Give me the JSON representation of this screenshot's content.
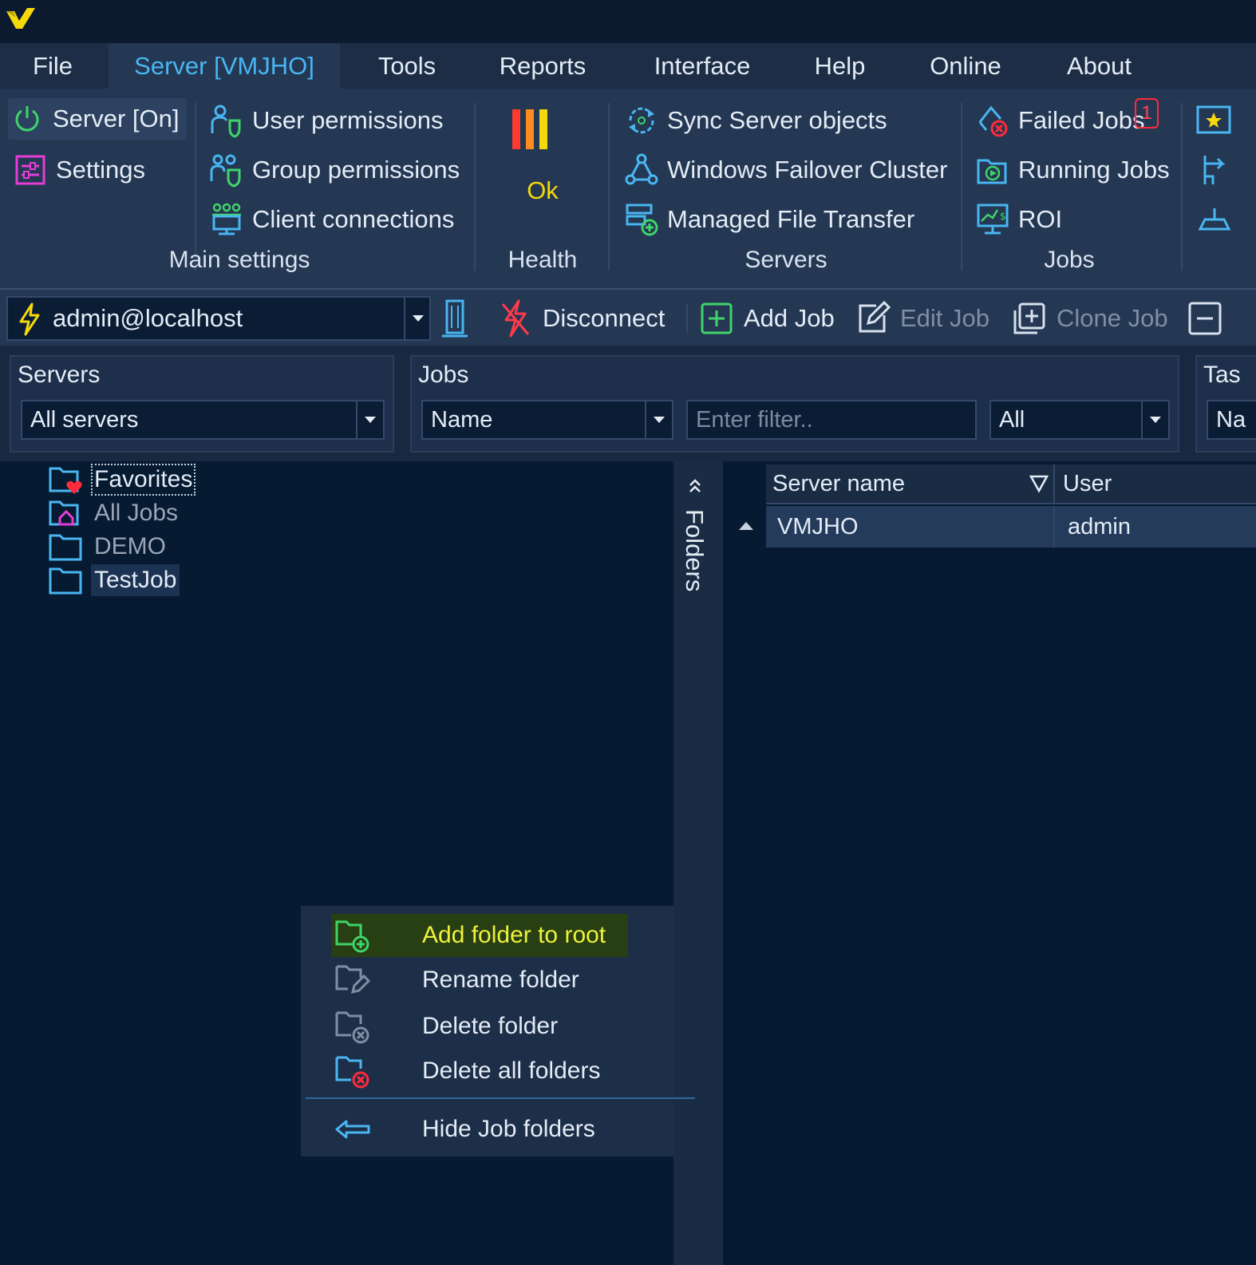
{
  "menu": {
    "tabs": [
      {
        "label": "File"
      },
      {
        "label": "Server [VMJHO]"
      },
      {
        "label": "Tools"
      },
      {
        "label": "Reports"
      },
      {
        "label": "Interface"
      },
      {
        "label": "Help"
      },
      {
        "label": "Online"
      },
      {
        "label": "About"
      }
    ],
    "active_tab": "Server [VMJHO]"
  },
  "ribbon": {
    "main_settings": {
      "title": "Main settings",
      "server_on": "Server [On]",
      "settings": "Settings",
      "user_permissions": "User permissions",
      "group_permissions": "Group permissions",
      "client_connections": "Client connections"
    },
    "health": {
      "title": "Health",
      "status": "Ok"
    },
    "servers": {
      "title": "Servers",
      "sync": "Sync Server objects",
      "failover": "Windows Failover Cluster",
      "mft": "Managed File Transfer"
    },
    "jobs": {
      "title": "Jobs",
      "failed": "Failed Jobs",
      "failed_count": "1",
      "running": "Running Jobs",
      "roi": "ROI"
    }
  },
  "toolbar": {
    "connection": "admin@localhost",
    "disconnect": "Disconnect",
    "add_job": "Add Job",
    "edit_job": "Edit Job",
    "clone_job": "Clone Job"
  },
  "filters": {
    "servers": {
      "label": "Servers",
      "value": "All servers"
    },
    "jobs": {
      "label": "Jobs",
      "field": "Name",
      "placeholder": "Enter filter..",
      "scope": "All"
    },
    "tasks": {
      "label": "Tas",
      "value": "Na"
    }
  },
  "folders": {
    "title": "Folders",
    "items": [
      {
        "label": "Favorites"
      },
      {
        "label": "All Jobs"
      },
      {
        "label": "DEMO"
      },
      {
        "label": "TestJob"
      }
    ]
  },
  "grid": {
    "columns": [
      "Server name",
      "User"
    ],
    "rows": [
      {
        "server": "VMJHO",
        "user": "admin"
      }
    ]
  },
  "context_menu": {
    "items": [
      {
        "label": "Add folder to root"
      },
      {
        "label": "Rename folder"
      },
      {
        "label": "Delete folder"
      },
      {
        "label": "Delete all folders"
      },
      {
        "label": "Hide Job folders"
      }
    ]
  },
  "colors": {
    "background": "#061a31",
    "ribbon": "#243753",
    "accent_blue": "#49b6f2",
    "highlight_yellow": "#eef23a",
    "health_ok": "#f5d90a",
    "error_red": "#ff2b3a"
  }
}
